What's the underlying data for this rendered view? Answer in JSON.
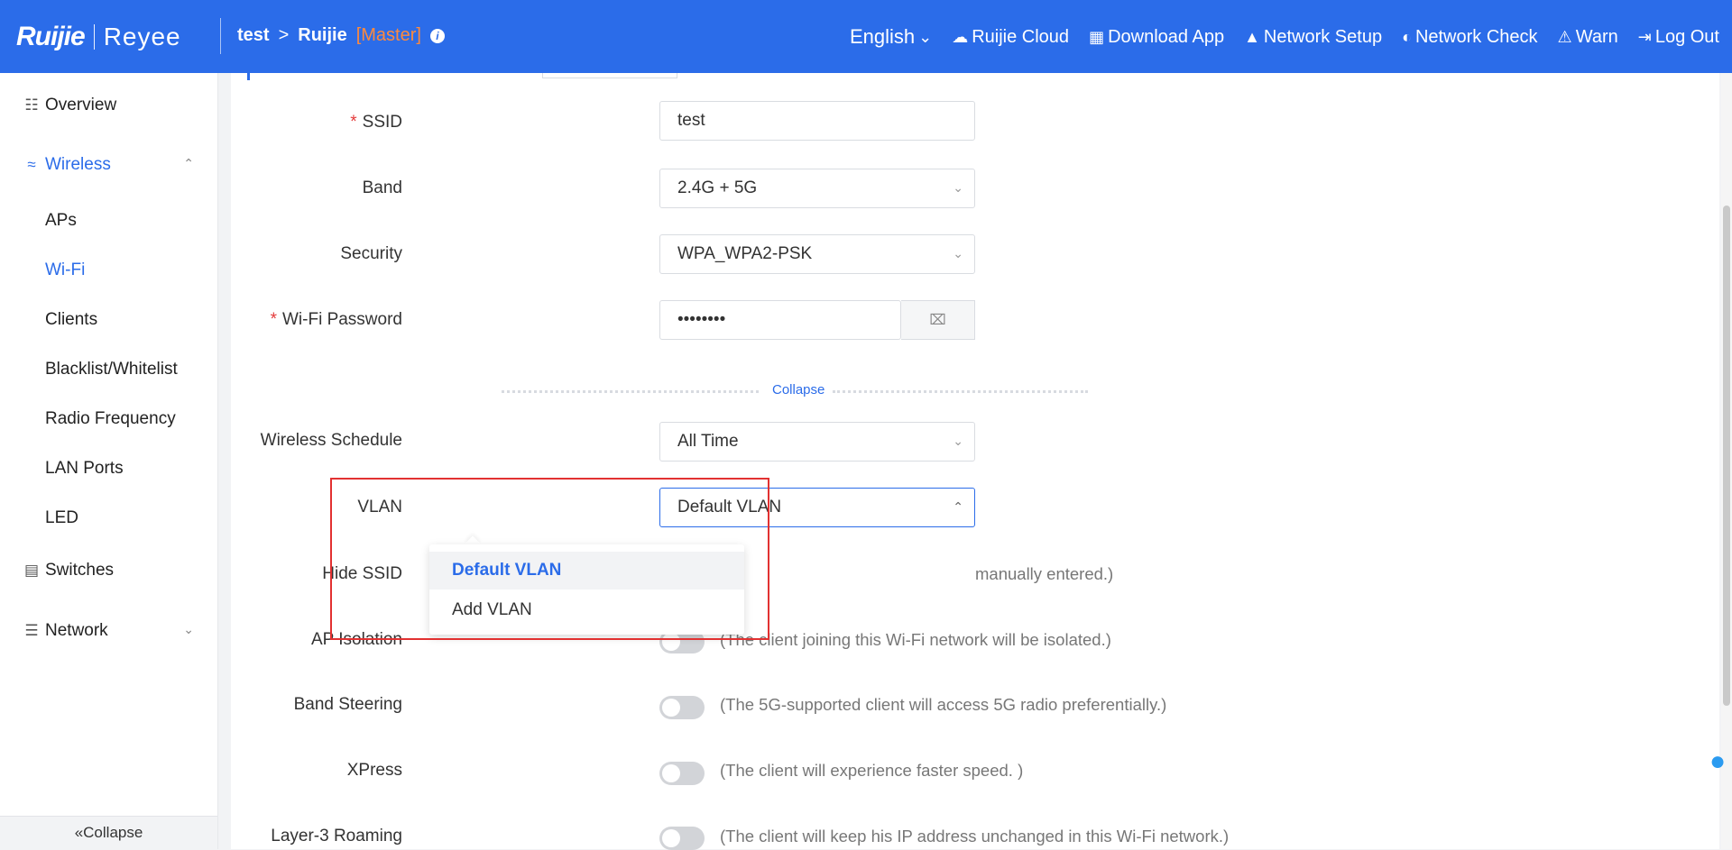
{
  "header": {
    "logo_main": "Ruijie",
    "logo_sub": "Reyee",
    "project": "test",
    "separator": ">",
    "device": "Ruijie",
    "role": "[Master]",
    "info_icon": "i",
    "nav": [
      {
        "label": "English",
        "icon": "chevron-down"
      },
      {
        "label": "Ruijie Cloud",
        "icon": "cloud"
      },
      {
        "label": "Download App",
        "icon": "qr-code"
      },
      {
        "label": "Network Setup",
        "icon": "rocket"
      },
      {
        "label": "Network Check",
        "icon": "network-check"
      },
      {
        "label": "Warn",
        "icon": "alarm"
      },
      {
        "label": "Log Out",
        "icon": "logout"
      }
    ]
  },
  "sidebar": {
    "items": [
      {
        "label": "Overview",
        "icon": "topology"
      },
      {
        "label": "Wireless",
        "icon": "wifi"
      },
      {
        "label": "Switches",
        "icon": "switch"
      },
      {
        "label": "Network",
        "icon": "network"
      }
    ],
    "wireless_sub": [
      "APs",
      "Wi-Fi",
      "Clients",
      "Blacklist/Whitelist",
      "Radio Frequency",
      "LAN Ports",
      "LED"
    ],
    "collapse_label": "Collapse"
  },
  "form": {
    "ssid": {
      "label": "SSID",
      "value": "test"
    },
    "band": {
      "label": "Band",
      "value": "2.4G + 5G"
    },
    "security": {
      "label": "Security",
      "value": "WPA_WPA2-PSK"
    },
    "password": {
      "label": "Wi-Fi Password",
      "value": "••••••••"
    },
    "collapse_label": "Collapse",
    "schedule": {
      "label": "Wireless Schedule",
      "value": "All Time"
    },
    "vlan": {
      "label": "VLAN",
      "value": "Default VLAN",
      "options": [
        "Default VLAN",
        "Add VLAN"
      ]
    },
    "hide_ssid": {
      "label": "Hide SSID",
      "desc": "manually entered.)"
    },
    "ap_isolation": {
      "label": "AP Isolation",
      "desc": "(The client joining this Wi-Fi network will be isolated.)"
    },
    "band_steering": {
      "label": "Band Steering",
      "desc": "(The 5G-supported client will access 5G radio preferentially.)"
    },
    "xpress": {
      "label": "XPress",
      "desc": "(The client will experience faster speed. )"
    },
    "roaming": {
      "label": "Layer-3 Roaming",
      "desc": "(The client will keep his IP address unchanged in this Wi-Fi network.)"
    }
  },
  "colors": {
    "primary": "#2b6ce9",
    "required": "#e43b3b",
    "highlight_box": "#e23131"
  }
}
